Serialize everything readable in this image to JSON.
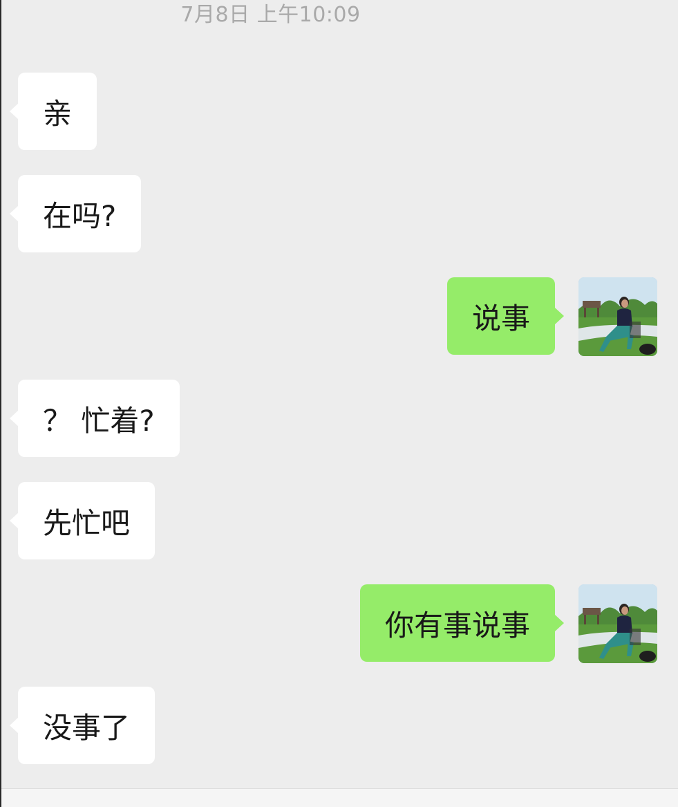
{
  "chat": {
    "timestamp": "7月8日 上午10:09",
    "messages": [
      {
        "side": "in",
        "text": "亲"
      },
      {
        "side": "in",
        "text": "在吗?"
      },
      {
        "side": "out",
        "text": "说事"
      },
      {
        "side": "in",
        "text": "？ 忙着?"
      },
      {
        "side": "in",
        "text": "先忙吧"
      },
      {
        "side": "out",
        "text": "你有事说事"
      },
      {
        "side": "in",
        "text": "没事了"
      }
    ]
  },
  "colors": {
    "background": "#ededed",
    "incoming_bubble": "#ffffff",
    "outgoing_bubble": "#95ec69",
    "timestamp_text": "#a9a9a9"
  },
  "icons": {
    "avatar": "user-avatar-photo"
  }
}
